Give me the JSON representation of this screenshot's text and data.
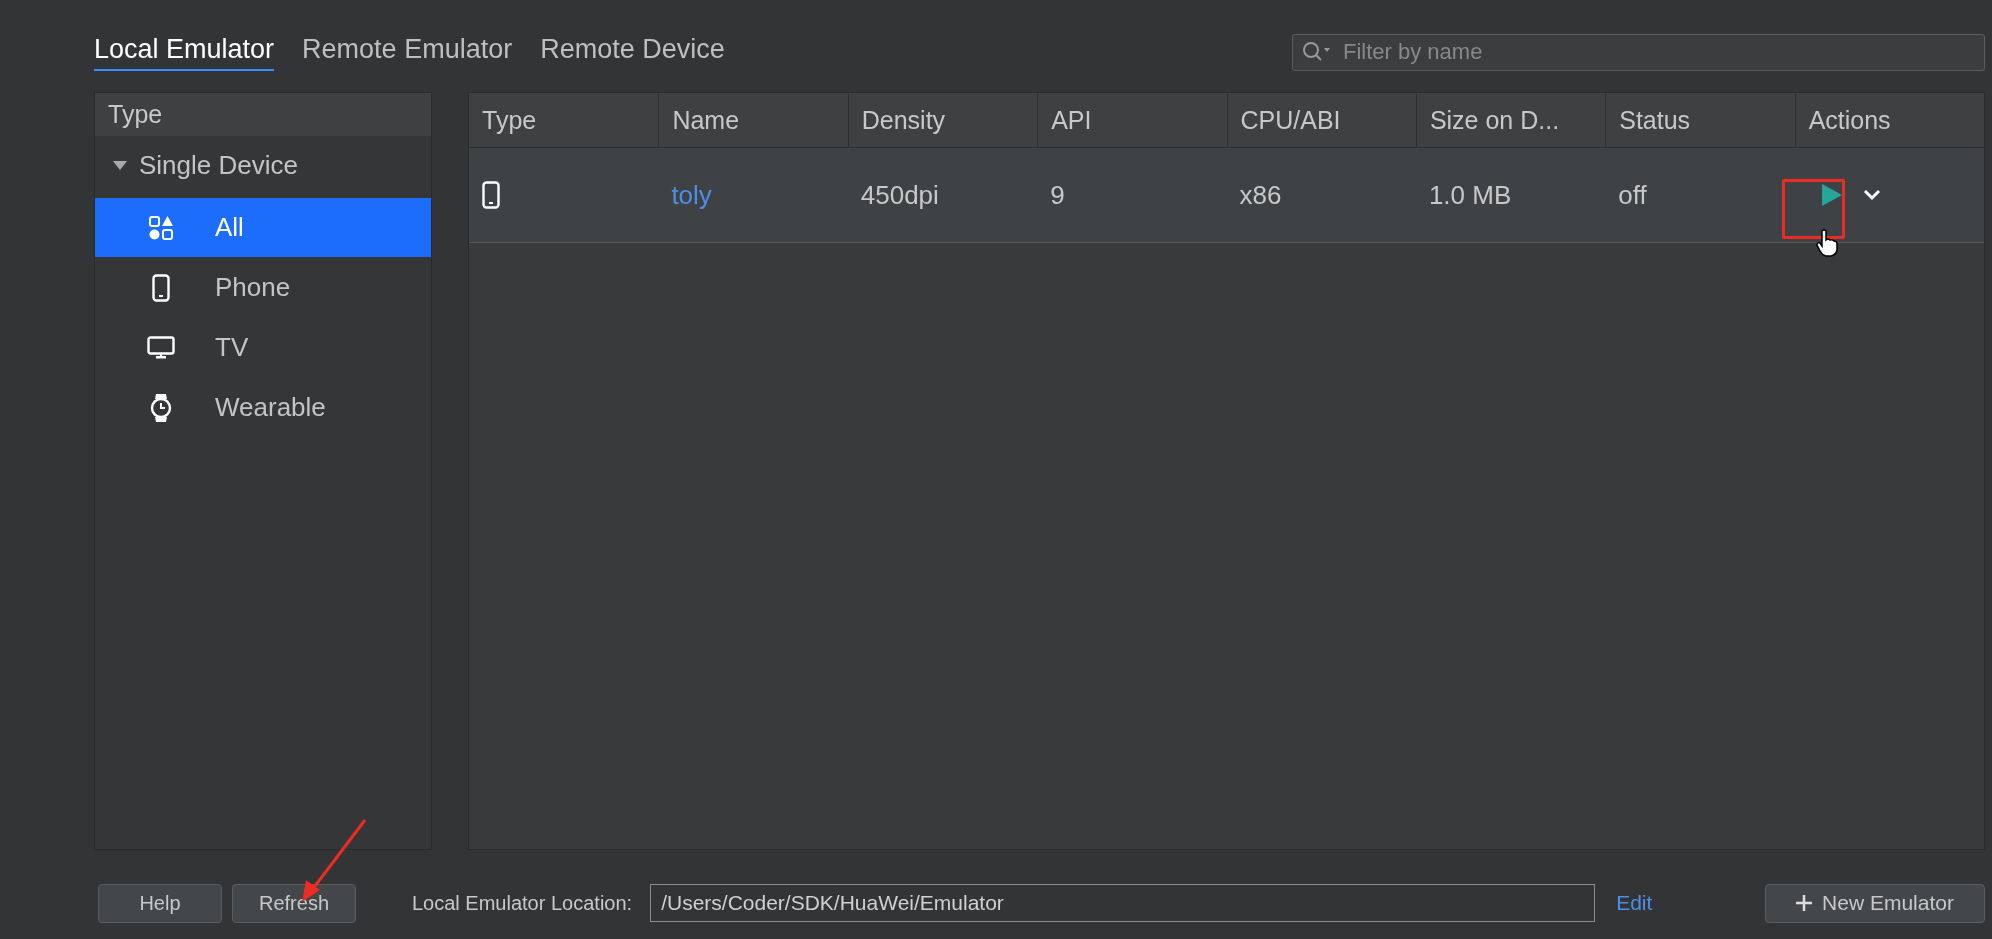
{
  "tabs": [
    {
      "label": "Local Emulator",
      "selected": true
    },
    {
      "label": "Remote Emulator",
      "selected": false
    },
    {
      "label": "Remote Device",
      "selected": false
    }
  ],
  "search": {
    "placeholder": "Filter by name"
  },
  "sidebar": {
    "header": "Type",
    "group": {
      "label": "Single Device",
      "expanded": true,
      "children": [
        {
          "label": "All",
          "kind": "all",
          "selected": true
        },
        {
          "label": "Phone",
          "kind": "phone",
          "selected": false
        },
        {
          "label": "TV",
          "kind": "tv",
          "selected": false
        },
        {
          "label": "Wearable",
          "kind": "wearable",
          "selected": false
        }
      ]
    }
  },
  "table": {
    "columns": [
      "Type",
      "Name",
      "Density",
      "API",
      "CPU/ABI",
      "Size on D...",
      "Status",
      "Actions"
    ],
    "rows": [
      {
        "kind": "phone",
        "name": "toly",
        "density": "450dpi",
        "api": "9",
        "cpu_abi": "x86",
        "size": "1.0 MB",
        "status": "off"
      }
    ]
  },
  "footer": {
    "buttons": [
      "Help",
      "Refresh"
    ],
    "location_label": "Local Emulator Location:",
    "location_value": "/Users/Coder/SDK/HuaWei/Emulator",
    "edit_link": "Edit",
    "new_button": "New Emulator"
  }
}
